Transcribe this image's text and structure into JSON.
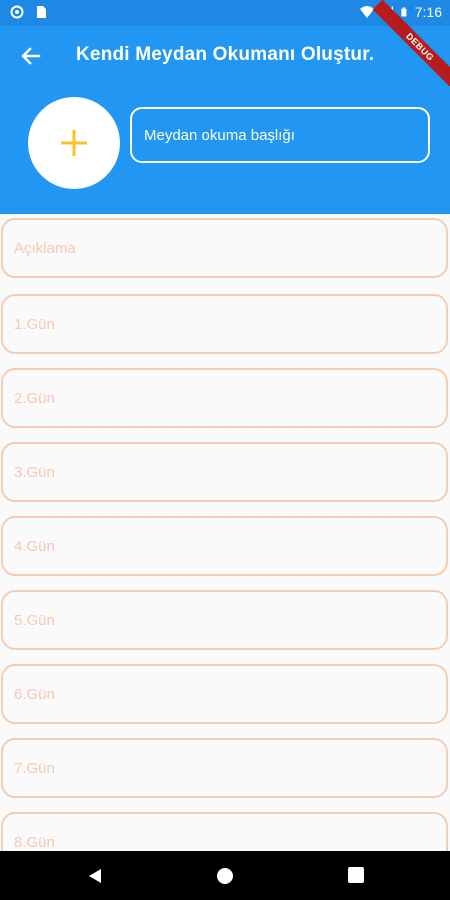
{
  "status_bar": {
    "time": "7:16",
    "icons": [
      "circle-icon",
      "sim-icon",
      "wifi-icon",
      "signal-icon",
      "battery-icon"
    ]
  },
  "app_bar": {
    "title": "Kendi Meydan Okumanı Oluştur.",
    "back_icon": "back-arrow-icon",
    "debug_label": "DEBUG"
  },
  "header": {
    "add_image_icon": "plus-icon",
    "title_field_placeholder": "Meydan okuma başlığı"
  },
  "fields": [
    {
      "placeholder": "Açıklama"
    },
    {
      "placeholder": "1.Gün"
    },
    {
      "placeholder": "2.Gün"
    },
    {
      "placeholder": "3.Gün"
    },
    {
      "placeholder": "4.Gün"
    },
    {
      "placeholder": "5.Gün"
    },
    {
      "placeholder": "6.Gün"
    },
    {
      "placeholder": "7.Gün"
    },
    {
      "placeholder": "8.Gün"
    }
  ],
  "colors": {
    "primary": "#2196f3",
    "status_bar": "#1e88e5",
    "accent": "#fbc02d",
    "field_border": "#f5cdb2",
    "field_hint": "#f6c8b5"
  }
}
